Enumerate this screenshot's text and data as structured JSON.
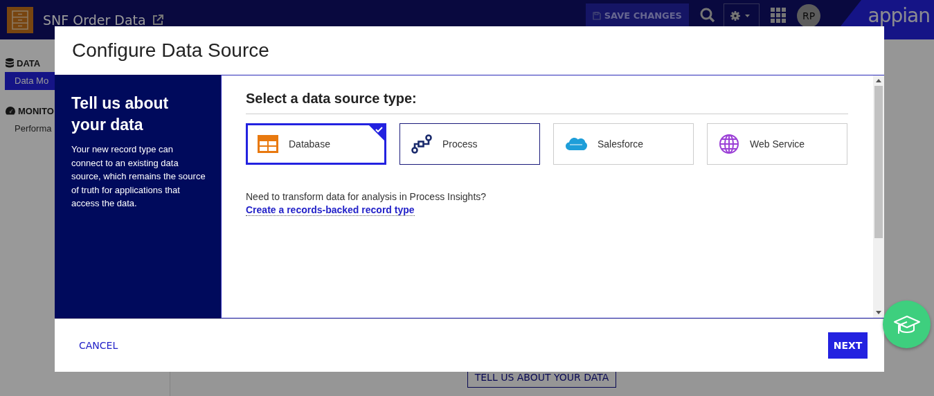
{
  "app_header": {
    "title": "SNF Order Data",
    "save_button": "SAVE CHANGES",
    "avatar": "RP",
    "logo": "appian"
  },
  "sidebar": {
    "sections": [
      {
        "label": "DATA",
        "kind": "database",
        "items": [
          {
            "label": "Data Mo",
            "selected": true
          }
        ]
      },
      {
        "label": "MONITO",
        "kind": "gauge",
        "items": [
          {
            "label": "Performa",
            "selected": false
          }
        ]
      }
    ]
  },
  "page": {
    "button": "TELL US ABOUT YOUR DATA"
  },
  "dialog": {
    "title": "Configure Data Source",
    "intro": {
      "heading": "Tell us about your data",
      "text": "Your new record type can connect to an existing data source, which remains the source of truth for applications that access the data."
    },
    "prompt": "Select a data source type:",
    "options": [
      {
        "label": "Database",
        "kind": "database",
        "selected": true,
        "focused": false
      },
      {
        "label": "Process",
        "kind": "process",
        "selected": false,
        "focused": true
      },
      {
        "label": "Salesforce",
        "kind": "salesforce",
        "selected": false,
        "focused": false
      },
      {
        "label": "Web Service",
        "kind": "globe",
        "selected": false,
        "focused": false
      }
    ],
    "note": "Need to transform data for analysis in Process Insights?",
    "link": "Create a records-backed record type",
    "cancel": "CANCEL",
    "next": "NEXT"
  }
}
